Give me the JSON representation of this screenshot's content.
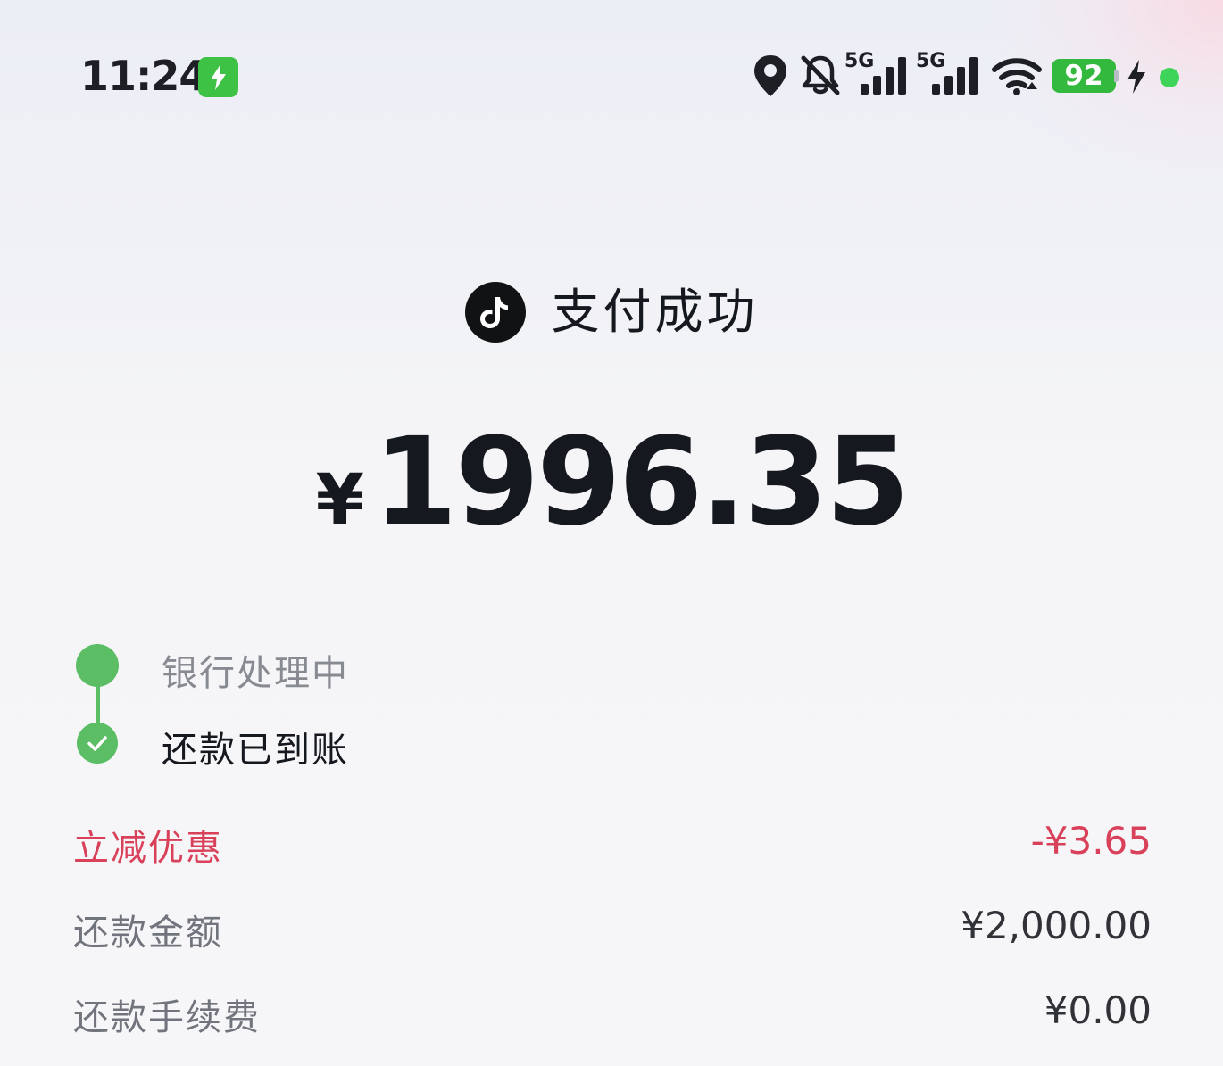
{
  "status_bar": {
    "time": "11:24",
    "network_1": "5G",
    "network_2": "5G",
    "battery_level": "92",
    "icons": [
      "charging-app-icon",
      "location-icon",
      "bell-off-icon",
      "signal-5g-icon",
      "signal-5g-icon",
      "wifi-icon",
      "battery-icon",
      "charging-bolt-icon",
      "dot-indicator"
    ]
  },
  "header": {
    "title": "支付成功",
    "brand_icon": "douyin-icon"
  },
  "payment": {
    "currency_symbol": "¥",
    "amount": "1996.35"
  },
  "timeline": {
    "steps": [
      {
        "label": "银行处理中",
        "state": "done"
      },
      {
        "label": "还款已到账",
        "state": "current"
      }
    ]
  },
  "details": [
    {
      "label": "立减优惠",
      "value": "-¥3.65"
    },
    {
      "label": "还款金额",
      "value": "¥2,000.00"
    },
    {
      "label": "还款手续费",
      "value": "¥0.00"
    }
  ],
  "colors": {
    "accent_green": "#5bbd64",
    "discount_red": "#d9415a",
    "battery_green": "#33b93d"
  }
}
